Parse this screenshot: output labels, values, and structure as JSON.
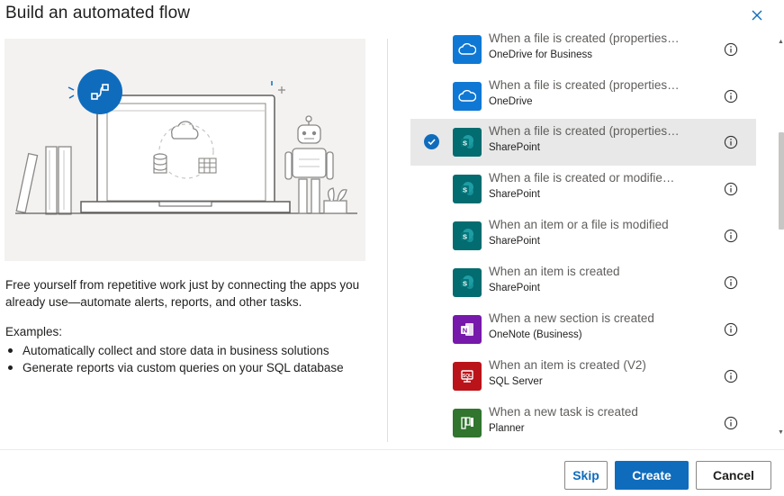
{
  "dialog": {
    "title": "Build an automated flow"
  },
  "intro": {
    "description": "Free yourself from repetitive work just by connecting the apps you already use—automate alerts, reports, and other tasks.",
    "examples_title": "Examples:",
    "examples": [
      "Automatically collect and store data in business solutions",
      "Generate reports via custom queries on your SQL database"
    ]
  },
  "triggers": [
    {
      "name": "When a file is created (properties only)",
      "connector": "OneDrive for Business",
      "icon": "onedrive-cloud-icon",
      "color": "#0f78d4",
      "selected": false
    },
    {
      "name": "When a file is created (properties only)",
      "connector": "OneDrive",
      "icon": "onedrive-cloud-icon",
      "color": "#0f78d4",
      "selected": false
    },
    {
      "name": "When a file is created (properties only)",
      "connector": "SharePoint",
      "icon": "sharepoint-icon",
      "color": "#036c70",
      "selected": true
    },
    {
      "name": "When a file is created or modified (properties only)",
      "connector": "SharePoint",
      "icon": "sharepoint-icon",
      "color": "#036c70",
      "selected": false
    },
    {
      "name": "When an item or a file is modified",
      "connector": "SharePoint",
      "icon": "sharepoint-icon",
      "color": "#036c70",
      "selected": false
    },
    {
      "name": "When an item is created",
      "connector": "SharePoint",
      "icon": "sharepoint-icon",
      "color": "#036c70",
      "selected": false
    },
    {
      "name": "When a new section is created",
      "connector": "OneNote (Business)",
      "icon": "onenote-icon",
      "color": "#7719aa",
      "selected": false
    },
    {
      "name": "When an item is created (V2)",
      "connector": "SQL Server",
      "icon": "sql-server-icon",
      "color": "#ba141a",
      "selected": false
    },
    {
      "name": "When a new task is created",
      "connector": "Planner",
      "icon": "planner-icon",
      "color": "#31752f",
      "selected": false
    }
  ],
  "footer": {
    "skip_label": "Skip",
    "create_label": "Create",
    "cancel_label": "Cancel"
  },
  "colors": {
    "accent": "#0f6cbd",
    "selected_row": "#e8e8e8"
  }
}
